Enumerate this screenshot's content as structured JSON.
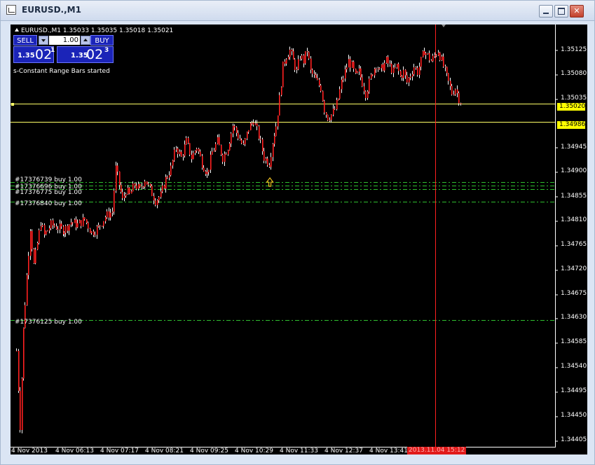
{
  "window": {
    "title": "EURUSD.,M1"
  },
  "chart_info": {
    "symbol_line": "EURUSD.,M1  1.35033 1.35035 1.35018 1.35021",
    "status_message": "s-Constant Range Bars started"
  },
  "trade_panel": {
    "sell_label": "SELL",
    "buy_label": "BUY",
    "lot_value": "1.00",
    "bid": {
      "big": "1.35",
      "digits": "02",
      "sup": "1"
    },
    "ask": {
      "big": "1.35",
      "digits": "02",
      "sup": "3"
    }
  },
  "orders": [
    "#17376739 buy 1.00",
    "#17376696 buy 1.00",
    "#17376775 buy 1.00",
    "#17376840 buy 1.00",
    "#17376125 buy 1.00"
  ],
  "price_axis": [
    "1.35125",
    "1.35080",
    "1.35035",
    "1.34945",
    "1.34900",
    "1.34855",
    "1.34810",
    "1.34765",
    "1.34720",
    "1.34675",
    "1.34630",
    "1.34585",
    "1.34540",
    "1.34495",
    "1.34450",
    "1.34405"
  ],
  "price_tags": {
    "bid_level": {
      "text": "1.35020",
      "color": "#ffff00"
    },
    "line_level": {
      "text": "1.34986",
      "color": "#ffff00"
    }
  },
  "time_axis": [
    "4 Nov 2013",
    "4 Nov 06:13",
    "4 Nov 07:17",
    "4 Nov 08:21",
    "4 Nov 09:25",
    "4 Nov 10:29",
    "4 Nov 11:33",
    "4 Nov 12:37",
    "4 Nov 13:41"
  ],
  "cursor_time": "2013.11.04 15:12",
  "colors": {
    "background": "#000000",
    "candle": "#ff2020",
    "wick": "#ffffff",
    "order_line": "#2fbf2f",
    "hline": "#ffff66",
    "cursor": "#ff2020"
  },
  "chart_data": {
    "type": "candlestick",
    "ylim": [
      1.34385,
      1.35155
    ],
    "xlim": [
      "4 Nov 2013 05:00",
      "4 Nov 2013 15:30"
    ],
    "close_path": [
      [
        "05:05",
        1.3456
      ],
      [
        "05:09",
        1.3442
      ],
      [
        "05:13",
        1.346
      ],
      [
        "05:17",
        1.347
      ],
      [
        "05:21",
        1.3479
      ],
      [
        "05:25",
        1.3472
      ],
      [
        "05:29",
        1.3476
      ],
      [
        "05:33",
        1.348
      ],
      [
        "05:37",
        1.34775
      ],
      [
        "05:45",
        1.34795
      ],
      [
        "05:53",
        1.3479
      ],
      [
        "06:00",
        1.34785
      ],
      [
        "06:08",
        1.348
      ],
      [
        "06:16",
        1.34795
      ],
      [
        "06:24",
        1.34805
      ],
      [
        "06:32",
        1.3478
      ],
      [
        "06:40",
        1.3479
      ],
      [
        "06:48",
        1.3481
      ],
      [
        "06:56",
        1.3482
      ],
      [
        "07:00",
        1.349
      ],
      [
        "07:04",
        1.3487
      ],
      [
        "07:08",
        1.3484
      ],
      [
        "07:12",
        1.3486
      ],
      [
        "07:16",
        1.3485
      ],
      [
        "07:22",
        1.3487
      ],
      [
        "07:28",
        1.3486
      ],
      [
        "07:34",
        1.3488
      ],
      [
        "07:40",
        1.3486
      ],
      [
        "07:46",
        1.3484
      ],
      [
        "07:52",
        1.3485
      ],
      [
        "07:58",
        1.3488
      ],
      [
        "08:04",
        1.349
      ],
      [
        "08:10",
        1.3494
      ],
      [
        "08:16",
        1.3492
      ],
      [
        "08:22",
        1.3495
      ],
      [
        "08:28",
        1.3492
      ],
      [
        "08:34",
        1.3494
      ],
      [
        "08:40",
        1.3491
      ],
      [
        "08:46",
        1.3489
      ],
      [
        "08:52",
        1.3493
      ],
      [
        "08:58",
        1.3495
      ],
      [
        "09:04",
        1.3492
      ],
      [
        "09:10",
        1.3494
      ],
      [
        "09:16",
        1.3498
      ],
      [
        "09:22",
        1.3496
      ],
      [
        "09:28",
        1.3494
      ],
      [
        "09:34",
        1.34975
      ],
      [
        "09:40",
        1.3499
      ],
      [
        "09:46",
        1.3496
      ],
      [
        "09:52",
        1.3492
      ],
      [
        "09:58",
        1.3491
      ],
      [
        "10:02",
        1.3495
      ],
      [
        "10:06",
        1.3498
      ],
      [
        "10:10",
        1.3503
      ],
      [
        "10:14",
        1.3509
      ],
      [
        "10:18",
        1.3511
      ],
      [
        "10:22",
        1.3512
      ],
      [
        "10:26",
        1.351
      ],
      [
        "10:30",
        1.3508
      ],
      [
        "10:34",
        1.3511
      ],
      [
        "10:38",
        1.351
      ],
      [
        "10:42",
        1.3512
      ],
      [
        "10:46",
        1.3508
      ],
      [
        "10:50",
        1.3507
      ],
      [
        "10:54",
        1.3506
      ],
      [
        "10:58",
        1.3505
      ],
      [
        "11:02",
        1.3501
      ],
      [
        "11:06",
        1.34995
      ],
      [
        "11:10",
        1.35
      ],
      [
        "11:14",
        1.3501
      ],
      [
        "11:18",
        1.3503
      ],
      [
        "11:22",
        1.3506
      ],
      [
        "11:26",
        1.3508
      ],
      [
        "11:30",
        1.351
      ],
      [
        "11:34",
        1.3509
      ],
      [
        "11:38",
        1.3507
      ],
      [
        "11:42",
        1.3508
      ],
      [
        "11:46",
        1.3506
      ],
      [
        "11:50",
        1.3504
      ],
      [
        "11:54",
        1.3506
      ],
      [
        "11:58",
        1.3508
      ],
      [
        "12:02",
        1.35095
      ],
      [
        "12:06",
        1.3508
      ],
      [
        "12:10",
        1.3509
      ],
      [
        "12:14",
        1.351
      ],
      [
        "12:18",
        1.3509
      ],
      [
        "12:22",
        1.3508
      ],
      [
        "12:26",
        1.3509
      ],
      [
        "12:30",
        1.3507
      ],
      [
        "12:34",
        1.3508
      ],
      [
        "12:38",
        1.3506
      ],
      [
        "12:42",
        1.35075
      ],
      [
        "12:46",
        1.3509
      ],
      [
        "12:50",
        1.3508
      ],
      [
        "12:54",
        1.351
      ],
      [
        "12:58",
        1.3512
      ],
      [
        "13:02",
        1.3511
      ],
      [
        "13:06",
        1.351
      ],
      [
        "13:10",
        1.3511
      ],
      [
        "13:14",
        1.3512
      ],
      [
        "13:18",
        1.351
      ],
      [
        "13:22",
        1.3508
      ],
      [
        "13:26",
        1.3506
      ],
      [
        "13:30",
        1.3504
      ],
      [
        "13:34",
        1.3505
      ],
      [
        "13:38",
        1.3503
      ],
      [
        "13:42",
        1.35021
      ]
    ],
    "horizontal_lines": [
      1.3502,
      1.34986
    ],
    "order_levels": [
      1.34875,
      1.34868,
      1.34862,
      1.34838,
      1.34617
    ],
    "arrow_marker": {
      "time": "09:58",
      "price": 1.3489,
      "direction": "up"
    }
  }
}
